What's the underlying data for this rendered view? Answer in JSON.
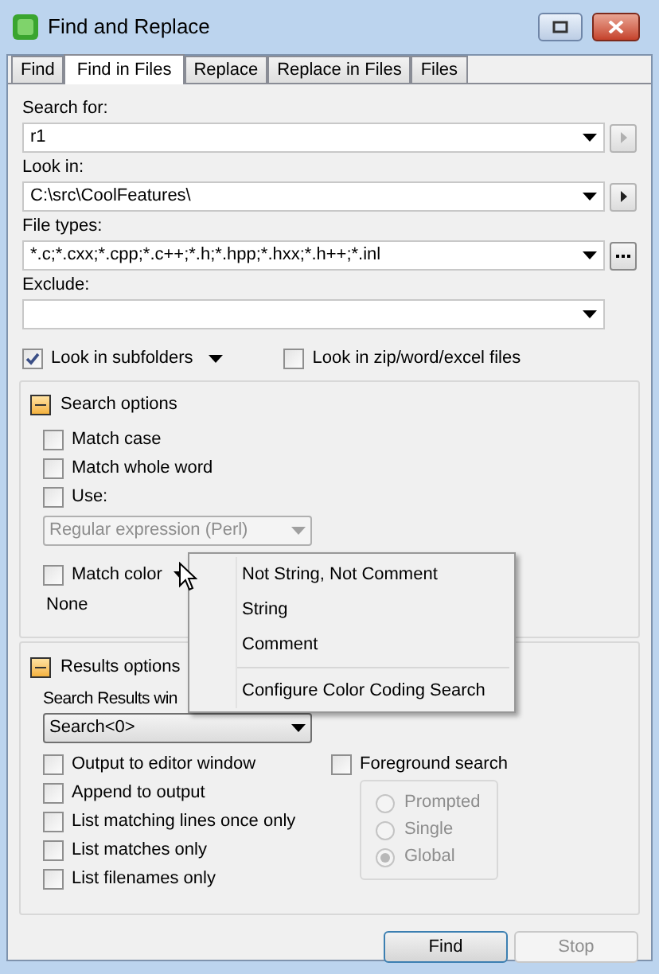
{
  "window": {
    "title": "Find and Replace"
  },
  "tabs": [
    {
      "label": "Find",
      "selected": false
    },
    {
      "label": "Find in Files",
      "selected": true
    },
    {
      "label": "Replace",
      "selected": false
    },
    {
      "label": "Replace in Files",
      "selected": false
    },
    {
      "label": "Files",
      "selected": false
    }
  ],
  "fields": [
    {
      "label": "Search for:",
      "value": "r1",
      "side_button": {
        "kind": "arrow",
        "disabled": true
      }
    },
    {
      "label": "Look in:",
      "value": "C:\\src\\CoolFeatures\\",
      "side_button": {
        "kind": "arrow",
        "disabled": false
      }
    },
    {
      "label": "File types:",
      "value": "*.c;*.cxx;*.cpp;*.c++;*.h;*.hpp;*.hxx;*.h++;*.inl",
      "side_button": {
        "kind": "ellipsis"
      }
    },
    {
      "label": "Exclude:"
    }
  ],
  "look_in_subfolders": {
    "label": "Look in subfolders",
    "checked": true
  },
  "look_in_archives": {
    "label": "Look in zip/word/excel files",
    "checked": false
  },
  "search_options": {
    "title": "Search options",
    "expanded": true,
    "options": [
      {
        "label": "Match case",
        "checked": false
      },
      {
        "label": "Match whole word",
        "checked": false
      },
      {
        "label": "Use:",
        "checked": false
      }
    ],
    "syntax": {
      "value": "Regular expression (Perl)",
      "disabled": true
    },
    "match_color": {
      "label": "Match color",
      "checked": false
    },
    "color_value": "None"
  },
  "results_options": {
    "title": "Results options",
    "expanded": true,
    "window_label": "Search Results win",
    "window_value": "Search<0>",
    "options": [
      {
        "label": "Output to editor window",
        "checked": false
      },
      {
        "label": "Append to output",
        "checked": false
      },
      {
        "label": "List matching lines once only",
        "checked": false
      },
      {
        "label": "List matches only",
        "checked": false
      },
      {
        "label": "List filenames only",
        "checked": false
      }
    ],
    "foreground": {
      "label": "Foreground search",
      "checked": false
    },
    "modes_disabled": true,
    "modes": [
      {
        "label": "Prompted",
        "selected": false
      },
      {
        "label": "Single",
        "selected": false
      },
      {
        "label": "Global",
        "selected": true
      }
    ]
  },
  "buttons": [
    {
      "label": "Find",
      "disabled": false,
      "default": true
    },
    {
      "label": "Stop",
      "disabled": true,
      "default": false
    }
  ],
  "color_menu": {
    "items": [
      {
        "kind": "item",
        "label": "Not String, Not Comment"
      },
      {
        "kind": "item",
        "label": "String"
      },
      {
        "kind": "item",
        "label": "Comment"
      },
      {
        "kind": "separator"
      },
      {
        "kind": "item",
        "label": "Configure Color Coding Search"
      }
    ]
  }
}
